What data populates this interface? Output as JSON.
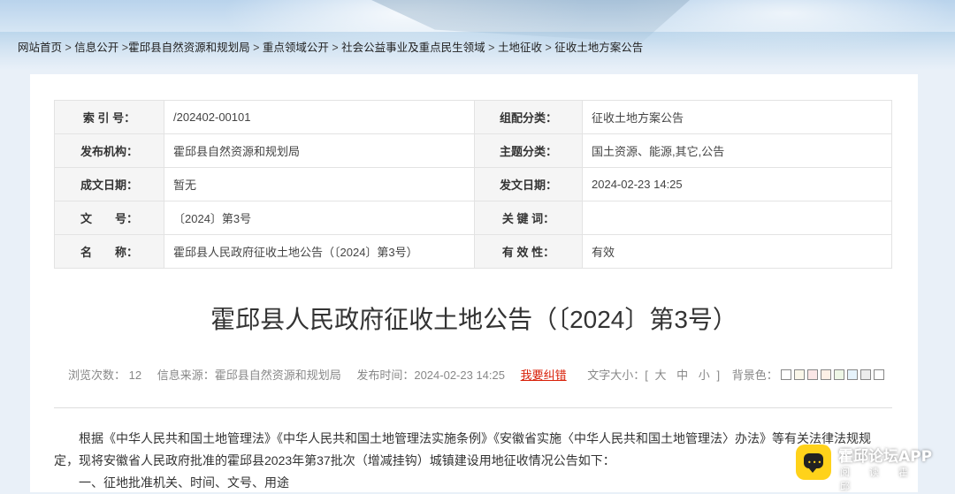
{
  "breadcrumb": [
    "网站首页",
    "信息公开",
    "霍邱县自然资源和规划局",
    "重点领域公开",
    "社会公益事业及重点民生领域",
    "土地征收",
    "征收土地方案公告"
  ],
  "meta": {
    "index_label": "索 引 号：",
    "index_value": "/202402-00101",
    "category_label": "组配分类：",
    "category_value": "征收土地方案公告",
    "publisher_label": "发布机构：",
    "publisher_value": "霍邱县自然资源和规划局",
    "topic_label": "主题分类：",
    "topic_value": "国土资源、能源,其它,公告",
    "created_label": "成文日期：",
    "created_value": "暂无",
    "published_label": "发文日期：",
    "published_value": "2024-02-23 14:25",
    "docno_label": "文　　号：",
    "docno_value": "〔2024〕第3号",
    "keywords_label": "关 键 词：",
    "keywords_value": "",
    "name_label": "名　　称：",
    "name_value": "霍邱县人民政府征收土地公告（〔2024〕第3号）",
    "validity_label": "有 效 性：",
    "validity_value": "有效"
  },
  "title": "霍邱县人民政府征收土地公告（〔2024〕第3号）",
  "info": {
    "views": "浏览次数： 12",
    "source": "信息来源：霍邱县自然资源和规划局",
    "time": "发布时间：2024-02-23 14:25",
    "report_error": "我要纠错",
    "font_size_label": "文字大小：[",
    "font_large": "大",
    "font_medium": "中",
    "font_small": "小",
    "font_close": "]",
    "bg_label": "背景色："
  },
  "bg_colors": [
    "#ffffff",
    "#faf6e9",
    "#fbe6e6",
    "#fdf0e6",
    "#eef7e6",
    "#e6f3fb",
    "#ececec",
    "#ffffff"
  ],
  "body": {
    "p1": "根据《中华人民共和国土地管理法》《中华人民共和国土地管理法实施条例》《安徽省实施〈中华人民共和国土地管理法〉办法》等有关法律法规规定，现将安徽省人民政府批准的霍邱县2023年第37批次（增减挂钩）城镇建设用地征收情况公告如下：",
    "p2": "一、征地批准机关、时间、文号、用途"
  },
  "watermark": {
    "title": "霍邱论坛APP",
    "subtitle": "阅读霍邱"
  }
}
